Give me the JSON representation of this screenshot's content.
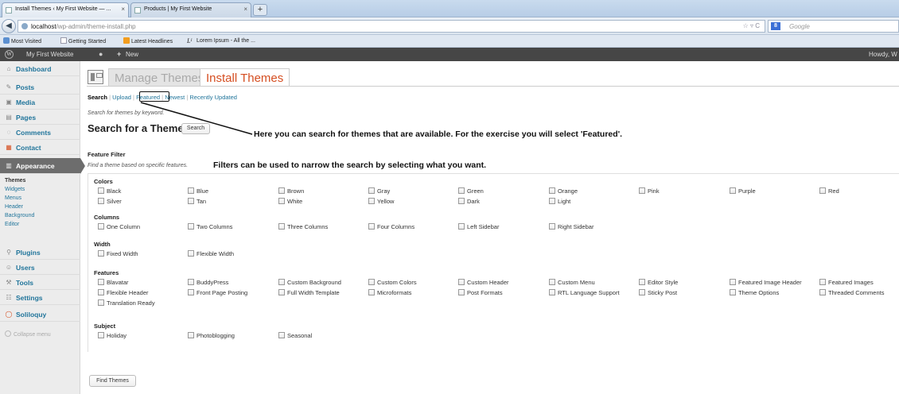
{
  "browser": {
    "tabs": [
      {
        "label": "Install Themes ‹ My First Website — ..."
      },
      {
        "label": "Products | My First Website"
      }
    ],
    "url_host": "localhost",
    "url_path": "/wp-admin/theme-install.php",
    "search_placeholder": "Google",
    "search_engine_letter": "8",
    "bookmarks": [
      "Most Visited",
      "Getting Started",
      "Latest Headlines",
      "Lorem Ipsum - All the ..."
    ]
  },
  "adminbar": {
    "site_name": "My First Website",
    "new_label": "New",
    "howdy": "Howdy, W"
  },
  "sidebar": {
    "items": [
      {
        "label": "Dashboard",
        "icon": "dashboard-icon"
      },
      {
        "label": "Posts",
        "icon": "posts-icon"
      },
      {
        "label": "Media",
        "icon": "media-icon"
      },
      {
        "label": "Pages",
        "icon": "pages-icon"
      },
      {
        "label": "Comments",
        "icon": "comments-icon"
      },
      {
        "label": "Contact",
        "icon": "contact-icon"
      },
      {
        "label": "Appearance",
        "icon": "appearance-icon"
      },
      {
        "label": "Plugins",
        "icon": "plugins-icon"
      },
      {
        "label": "Users",
        "icon": "users-icon"
      },
      {
        "label": "Tools",
        "icon": "tools-icon"
      },
      {
        "label": "Settings",
        "icon": "settings-icon"
      },
      {
        "label": "Soliloquy",
        "icon": "soliloquy-icon"
      }
    ],
    "appearance_sub": [
      "Themes",
      "Widgets",
      "Menus",
      "Header",
      "Background",
      "Editor"
    ],
    "collapse_label": "Collapse menu"
  },
  "main": {
    "tab_manage": "Manage Themes",
    "tab_install": "Install Themes",
    "subsub": {
      "search": "Search",
      "upload": "Upload",
      "featured": "Featured",
      "newest": "Newest",
      "recently_updated": "Recently Updated",
      "sep": " | "
    },
    "search_hint": "Search for themes by keyword.",
    "search_type": "Search for a Theme",
    "search_button": "Search",
    "feature_filter_title": "Feature Filter",
    "feature_filter_desc": "Find a theme based on specific features.",
    "annotation_search": "Here you can search for themes that are available. For the exercise you will select 'Featured'.",
    "annotation_filter": "Filters can be used to narrow the search by selecting what you want.",
    "filter_groups": [
      {
        "title": "Colors",
        "options": [
          "Black",
          "Blue",
          "Brown",
          "Gray",
          "Green",
          "Orange",
          "Pink",
          "Purple",
          "Red",
          "Silver",
          "Tan",
          "White",
          "Yellow",
          "Dark",
          "Light"
        ]
      },
      {
        "title": "Columns",
        "options": [
          "One Column",
          "Two Columns",
          "Three Columns",
          "Four Columns",
          "Left Sidebar",
          "Right Sidebar"
        ]
      },
      {
        "title": "Width",
        "options": [
          "Fixed Width",
          "Flexible Width"
        ]
      },
      {
        "title": "Features",
        "options": [
          "Blavatar",
          "BuddyPress",
          "Custom Background",
          "Custom Colors",
          "Custom Header",
          "Custom Menu",
          "Editor Style",
          "Featured Image Header",
          "Featured Images",
          "Flexible Header",
          "Front Page Posting",
          "Full Width Template",
          "Microformats",
          "Post Formats",
          "RTL Language Support",
          "Sticky Post",
          "Theme Options",
          "Threaded Comments",
          "Translation Ready"
        ]
      },
      {
        "title": "Subject",
        "options": [
          "Holiday",
          "Photoblogging",
          "Seasonal"
        ]
      }
    ],
    "find_button": "Find Themes"
  },
  "colors": {
    "link": "#21759b",
    "active_tab": "#d54e21",
    "admin_bar": "#464646",
    "sidebar_active": "#6d6d6d"
  }
}
